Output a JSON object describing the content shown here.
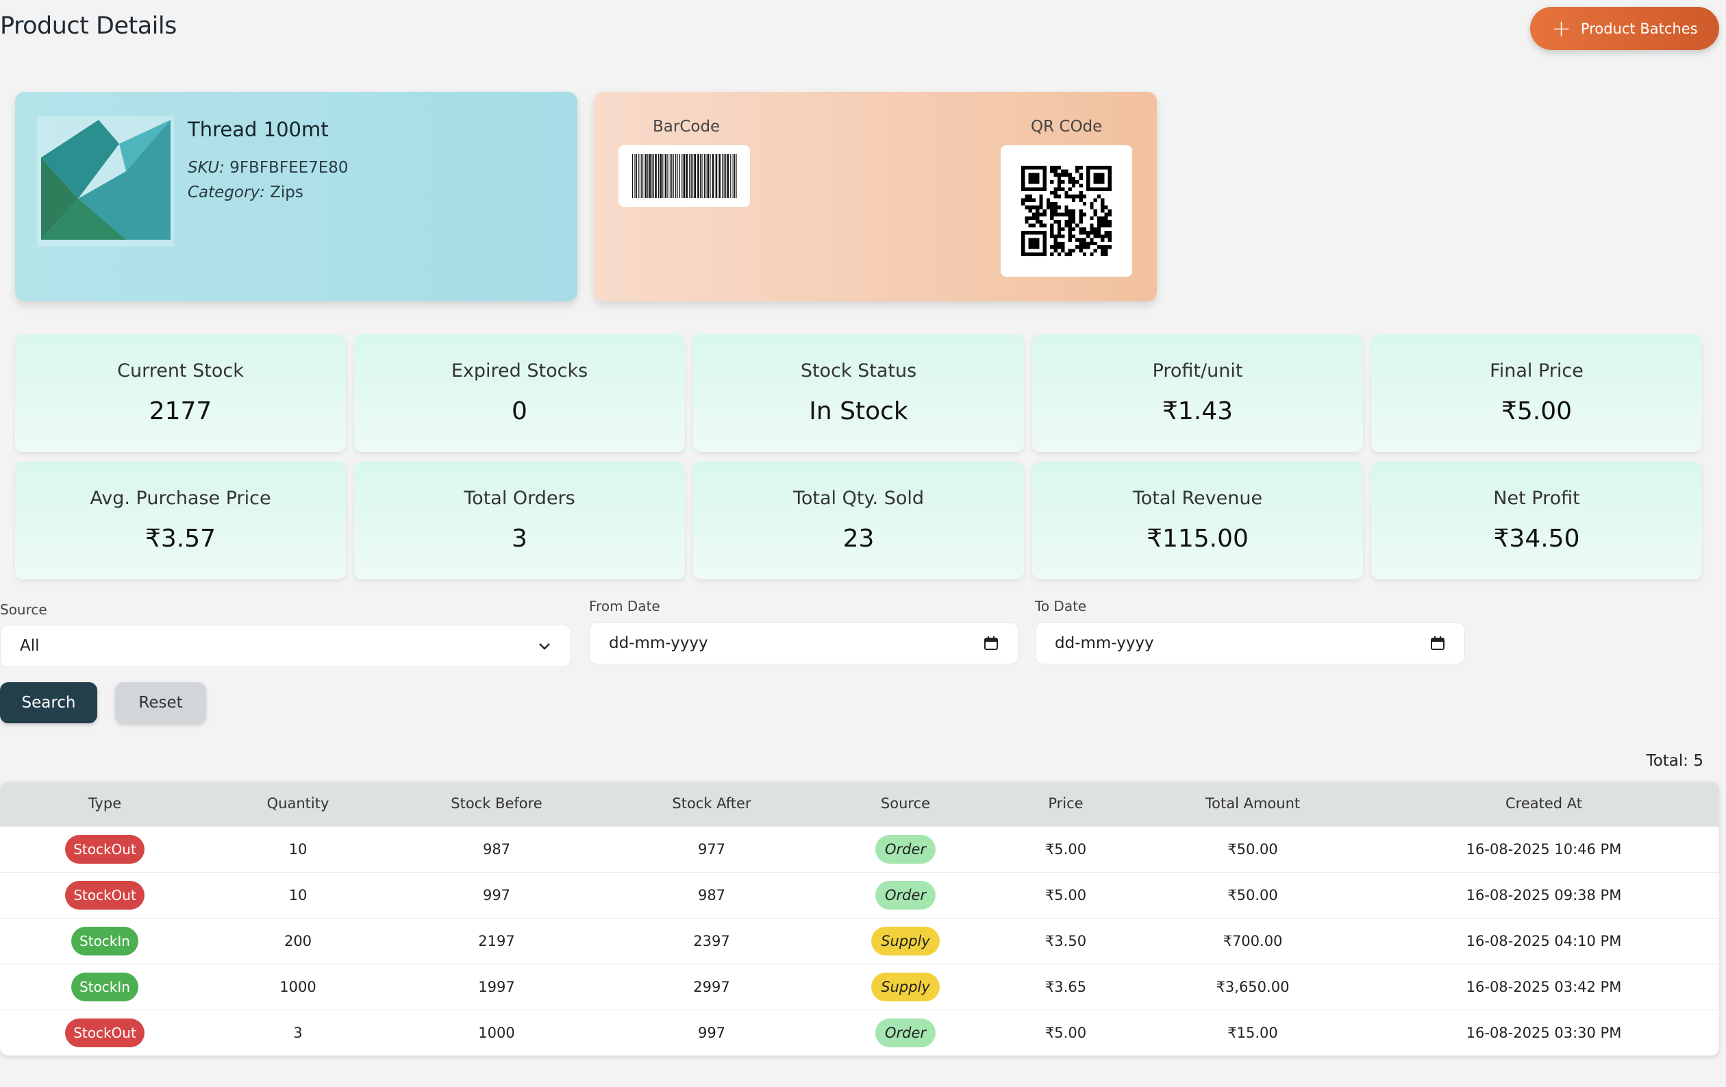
{
  "header": {
    "title": "Product Details",
    "batches_label": "Product Batches"
  },
  "product": {
    "name": "Thread 100mt",
    "sku_label": "SKU:",
    "sku": "9FBFBFEE7E80",
    "category_label": "Category:",
    "category": "Zips"
  },
  "codes": {
    "barcode_label": "BarCode",
    "qr_label": "QR COde"
  },
  "stats": [
    {
      "label": "Current Stock",
      "value": "2177"
    },
    {
      "label": "Expired Stocks",
      "value": "0"
    },
    {
      "label": "Stock Status",
      "value": "In Stock"
    },
    {
      "label": "Profit/unit",
      "value": "₹1.43"
    },
    {
      "label": "Final Price",
      "value": "₹5.00"
    },
    {
      "label": "Avg. Purchase Price",
      "value": "₹3.57"
    },
    {
      "label": "Total Orders",
      "value": "3"
    },
    {
      "label": "Total Qty. Sold",
      "value": "23"
    },
    {
      "label": "Total Revenue",
      "value": "₹115.00"
    },
    {
      "label": "Net Profit",
      "value": "₹34.50"
    }
  ],
  "filters": {
    "source_label": "Source",
    "source_value": "All",
    "from_label": "From Date",
    "from_value": "dd-mm-yyyy",
    "to_label": "To Date",
    "to_value": "dd-mm-yyyy",
    "search_label": "Search",
    "reset_label": "Reset"
  },
  "table": {
    "total_label": "Total: 5",
    "columns": [
      "Type",
      "Quantity",
      "Stock Before",
      "Stock After",
      "Source",
      "Price",
      "Total Amount",
      "Created At"
    ],
    "rows": [
      {
        "type": "StockOut",
        "qty": "10",
        "before": "987",
        "after": "977",
        "source": "Order",
        "price": "₹5.00",
        "total": "₹50.00",
        "created": "16-08-2025 10:46 PM"
      },
      {
        "type": "StockOut",
        "qty": "10",
        "before": "997",
        "after": "987",
        "source": "Order",
        "price": "₹5.00",
        "total": "₹50.00",
        "created": "16-08-2025 09:38 PM"
      },
      {
        "type": "StockIn",
        "qty": "200",
        "before": "2197",
        "after": "2397",
        "source": "Supply",
        "price": "₹3.50",
        "total": "₹700.00",
        "created": "16-08-2025 04:10 PM"
      },
      {
        "type": "StockIn",
        "qty": "1000",
        "before": "1997",
        "after": "2997",
        "source": "Supply",
        "price": "₹3.65",
        "total": "₹3,650.00",
        "created": "16-08-2025 03:42 PM"
      },
      {
        "type": "StockOut",
        "qty": "3",
        "before": "1000",
        "after": "997",
        "source": "Order",
        "price": "₹5.00",
        "total": "₹15.00",
        "created": "16-08-2025 03:30 PM"
      }
    ]
  },
  "colors": {
    "accent": "#e06a35",
    "stock_out": "#d64545",
    "stock_in": "#4caf50",
    "order": "#a5e6b0",
    "supply": "#f2d13c"
  }
}
